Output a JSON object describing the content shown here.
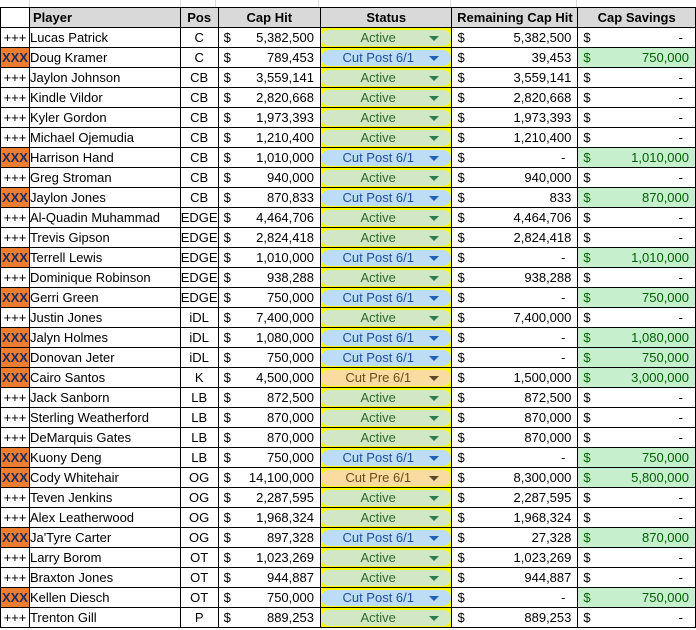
{
  "columns": {
    "marker": "",
    "player": "Player",
    "pos": "Pos",
    "cap_hit": "Cap Hit",
    "status": "Status",
    "remaining_cap_hit": "Remaining Cap Hit",
    "cap_savings": "Cap Savings"
  },
  "currency_symbol": "$",
  "status_colors": {
    "Active": "#d2e8c4",
    "Cut Post 6/1": "#bddcf5",
    "Cut Pre 6/1": "#fbdca0",
    "status_column_fill": "#ffff00",
    "cut_marker_fill": "#ed7d31",
    "savings_fill": "#c6efce"
  },
  "rows": [
    {
      "marker": "+++",
      "player": "Lucas Patrick",
      "pos": "C",
      "cap_hit": "5,382,500",
      "status": "Active",
      "remaining": "5,382,500",
      "savings": "-"
    },
    {
      "marker": "XXX",
      "player": "Doug Kramer",
      "pos": "C",
      "cap_hit": "789,453",
      "status": "Cut Post 6/1",
      "remaining": "39,453",
      "savings": "750,000"
    },
    {
      "marker": "+++",
      "player": "Jaylon Johnson",
      "pos": "CB",
      "cap_hit": "3,559,141",
      "status": "Active",
      "remaining": "3,559,141",
      "savings": "-"
    },
    {
      "marker": "+++",
      "player": "Kindle Vildor",
      "pos": "CB",
      "cap_hit": "2,820,668",
      "status": "Active",
      "remaining": "2,820,668",
      "savings": "-"
    },
    {
      "marker": "+++",
      "player": "Kyler Gordon",
      "pos": "CB",
      "cap_hit": "1,973,393",
      "status": "Active",
      "remaining": "1,973,393",
      "savings": "-"
    },
    {
      "marker": "+++",
      "player": "Michael Ojemudia",
      "pos": "CB",
      "cap_hit": "1,210,400",
      "status": "Active",
      "remaining": "1,210,400",
      "savings": "-"
    },
    {
      "marker": "XXX",
      "player": "Harrison Hand",
      "pos": "CB",
      "cap_hit": "1,010,000",
      "status": "Cut Post 6/1",
      "remaining": "-",
      "savings": "1,010,000"
    },
    {
      "marker": "+++",
      "player": "Greg Stroman",
      "pos": "CB",
      "cap_hit": "940,000",
      "status": "Active",
      "remaining": "940,000",
      "savings": "-"
    },
    {
      "marker": "XXX",
      "player": "Jaylon Jones",
      "pos": "CB",
      "cap_hit": "870,833",
      "status": "Cut Post 6/1",
      "remaining": "833",
      "savings": "870,000"
    },
    {
      "marker": "+++",
      "player": "Al-Quadin Muhammad",
      "pos": "EDGE",
      "cap_hit": "4,464,706",
      "status": "Active",
      "remaining": "4,464,706",
      "savings": "-"
    },
    {
      "marker": "+++",
      "player": "Trevis Gipson",
      "pos": "EDGE",
      "cap_hit": "2,824,418",
      "status": "Active",
      "remaining": "2,824,418",
      "savings": "-"
    },
    {
      "marker": "XXX",
      "player": "Terrell Lewis",
      "pos": "EDGE",
      "cap_hit": "1,010,000",
      "status": "Cut Post 6/1",
      "remaining": "-",
      "savings": "1,010,000"
    },
    {
      "marker": "+++",
      "player": "Dominique Robinson",
      "pos": "EDGE",
      "cap_hit": "938,288",
      "status": "Active",
      "remaining": "938,288",
      "savings": "-"
    },
    {
      "marker": "XXX",
      "player": "Gerri Green",
      "pos": "EDGE",
      "cap_hit": "750,000",
      "status": "Cut Post 6/1",
      "remaining": "-",
      "savings": "750,000"
    },
    {
      "marker": "+++",
      "player": "Justin Jones",
      "pos": "iDL",
      "cap_hit": "7,400,000",
      "status": "Active",
      "remaining": "7,400,000",
      "savings": "-"
    },
    {
      "marker": "XXX",
      "player": "Jalyn Holmes",
      "pos": "iDL",
      "cap_hit": "1,080,000",
      "status": "Cut Post 6/1",
      "remaining": "-",
      "savings": "1,080,000"
    },
    {
      "marker": "XXX",
      "player": "Donovan Jeter",
      "pos": "iDL",
      "cap_hit": "750,000",
      "status": "Cut Post 6/1",
      "remaining": "-",
      "savings": "750,000"
    },
    {
      "marker": "XXX",
      "player": "Cairo Santos",
      "pos": "K",
      "cap_hit": "4,500,000",
      "status": "Cut Pre 6/1",
      "remaining": "1,500,000",
      "savings": "3,000,000"
    },
    {
      "marker": "+++",
      "player": "Jack Sanborn",
      "pos": "LB",
      "cap_hit": "872,500",
      "status": "Active",
      "remaining": "872,500",
      "savings": "-"
    },
    {
      "marker": "+++",
      "player": "Sterling Weatherford",
      "pos": "LB",
      "cap_hit": "870,000",
      "status": "Active",
      "remaining": "870,000",
      "savings": "-"
    },
    {
      "marker": "+++",
      "player": "DeMarquis Gates",
      "pos": "LB",
      "cap_hit": "870,000",
      "status": "Active",
      "remaining": "870,000",
      "savings": "-"
    },
    {
      "marker": "XXX",
      "player": "Kuony Deng",
      "pos": "LB",
      "cap_hit": "750,000",
      "status": "Cut Post 6/1",
      "remaining": "-",
      "savings": "750,000"
    },
    {
      "marker": "XXX",
      "player": "Cody Whitehair",
      "pos": "OG",
      "cap_hit": "14,100,000",
      "status": "Cut Pre 6/1",
      "remaining": "8,300,000",
      "savings": "5,800,000"
    },
    {
      "marker": "+++",
      "player": "Teven Jenkins",
      "pos": "OG",
      "cap_hit": "2,287,595",
      "status": "Active",
      "remaining": "2,287,595",
      "savings": "-"
    },
    {
      "marker": "+++",
      "player": "Alex Leatherwood",
      "pos": "OG",
      "cap_hit": "1,968,324",
      "status": "Active",
      "remaining": "1,968,324",
      "savings": "-"
    },
    {
      "marker": "XXX",
      "player": "Ja'Tyre Carter",
      "pos": "OG",
      "cap_hit": "897,328",
      "status": "Cut Post 6/1",
      "remaining": "27,328",
      "savings": "870,000"
    },
    {
      "marker": "+++",
      "player": "Larry Borom",
      "pos": "OT",
      "cap_hit": "1,023,269",
      "status": "Active",
      "remaining": "1,023,269",
      "savings": "-"
    },
    {
      "marker": "+++",
      "player": "Braxton Jones",
      "pos": "OT",
      "cap_hit": "944,887",
      "status": "Active",
      "remaining": "944,887",
      "savings": "-"
    },
    {
      "marker": "XXX",
      "player": "Kellen Diesch",
      "pos": "OT",
      "cap_hit": "750,000",
      "status": "Cut Post 6/1",
      "remaining": "-",
      "savings": "750,000"
    },
    {
      "marker": "+++",
      "player": "Trenton Gill",
      "pos": "P",
      "cap_hit": "889,253",
      "status": "Active",
      "remaining": "889,253",
      "savings": "-"
    }
  ]
}
